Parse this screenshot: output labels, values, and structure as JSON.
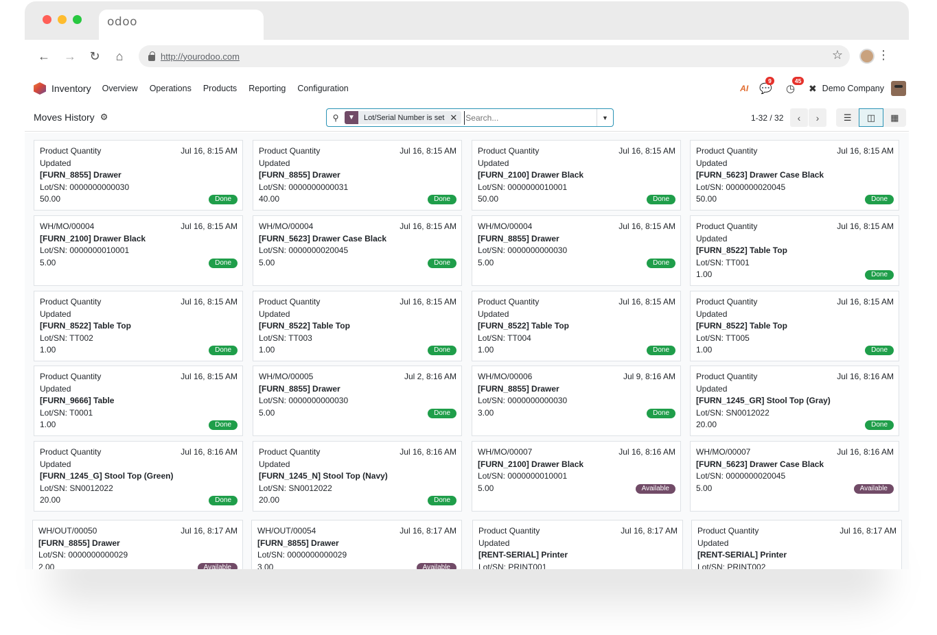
{
  "browser": {
    "tab_title": "odoo",
    "url": "http://yourodoo.com"
  },
  "navbar": {
    "app_name": "Inventory",
    "menu": [
      "Overview",
      "Operations",
      "Products",
      "Reporting",
      "Configuration"
    ],
    "ai_label": "AI",
    "messages_count": "9",
    "activities_count": "45",
    "company": "Demo Company"
  },
  "control": {
    "title": "Moves History",
    "facet_label": "Lot/Serial Number is set",
    "search_placeholder": "Search...",
    "pager": "1-32 / 32"
  },
  "cards": [
    {
      "ref": "Product Quantity",
      "ref2": "Updated",
      "date": "Jul 16, 8:15 AM",
      "product": "[FURN_8855] Drawer",
      "lot": "Lot/SN: 0000000000030",
      "qty": "50.00",
      "state": "Done"
    },
    {
      "ref": "Product Quantity",
      "ref2": "Updated",
      "date": "Jul 16, 8:15 AM",
      "product": "[FURN_8855] Drawer",
      "lot": "Lot/SN: 0000000000031",
      "qty": "40.00",
      "state": "Done"
    },
    {
      "ref": "Product Quantity",
      "ref2": "Updated",
      "date": "Jul 16, 8:15 AM",
      "product": "[FURN_2100] Drawer Black",
      "lot": "Lot/SN: 0000000010001",
      "qty": "50.00",
      "state": "Done"
    },
    {
      "ref": "Product Quantity",
      "ref2": "Updated",
      "date": "Jul 16, 8:15 AM",
      "product": "[FURN_5623] Drawer Case Black",
      "lot": "Lot/SN: 0000000020045",
      "qty": "50.00",
      "state": "Done"
    },
    {
      "ref": "WH/MO/00004",
      "ref2": "",
      "date": "Jul 16, 8:15 AM",
      "product": "[FURN_2100] Drawer Black",
      "lot": "Lot/SN: 0000000010001",
      "qty": "5.00",
      "state": "Done"
    },
    {
      "ref": "WH/MO/00004",
      "ref2": "",
      "date": "Jul 16, 8:15 AM",
      "product": "[FURN_5623] Drawer Case Black",
      "lot": "Lot/SN: 0000000020045",
      "qty": "5.00",
      "state": "Done"
    },
    {
      "ref": "WH/MO/00004",
      "ref2": "",
      "date": "Jul 16, 8:15 AM",
      "product": "[FURN_8855] Drawer",
      "lot": "Lot/SN: 0000000000030",
      "qty": "5.00",
      "state": "Done"
    },
    {
      "ref": "Product Quantity",
      "ref2": "Updated",
      "date": "Jul 16, 8:15 AM",
      "product": "[FURN_8522] Table Top",
      "lot": "Lot/SN: TT001",
      "qty": "1.00",
      "state": "Done"
    },
    {
      "ref": "Product Quantity",
      "ref2": "Updated",
      "date": "Jul 16, 8:15 AM",
      "product": "[FURN_8522] Table Top",
      "lot": "Lot/SN: TT002",
      "qty": "1.00",
      "state": "Done"
    },
    {
      "ref": "Product Quantity",
      "ref2": "Updated",
      "date": "Jul 16, 8:15 AM",
      "product": "[FURN_8522] Table Top",
      "lot": "Lot/SN: TT003",
      "qty": "1.00",
      "state": "Done"
    },
    {
      "ref": "Product Quantity",
      "ref2": "Updated",
      "date": "Jul 16, 8:15 AM",
      "product": "[FURN_8522] Table Top",
      "lot": "Lot/SN: TT004",
      "qty": "1.00",
      "state": "Done"
    },
    {
      "ref": "Product Quantity",
      "ref2": "Updated",
      "date": "Jul 16, 8:15 AM",
      "product": "[FURN_8522] Table Top",
      "lot": "Lot/SN: TT005",
      "qty": "1.00",
      "state": "Done"
    },
    {
      "ref": "Product Quantity",
      "ref2": "Updated",
      "date": "Jul 16, 8:15 AM",
      "product": "[FURN_9666] Table",
      "lot": "Lot/SN: T0001",
      "qty": "1.00",
      "state": "Done"
    },
    {
      "ref": "WH/MO/00005",
      "ref2": "",
      "date": "Jul 2, 8:16 AM",
      "product": "[FURN_8855] Drawer",
      "lot": "Lot/SN: 0000000000030",
      "qty": "5.00",
      "state": "Done"
    },
    {
      "ref": "WH/MO/00006",
      "ref2": "",
      "date": "Jul 9, 8:16 AM",
      "product": "[FURN_8855] Drawer",
      "lot": "Lot/SN: 0000000000030",
      "qty": "3.00",
      "state": "Done"
    },
    {
      "ref": "Product Quantity",
      "ref2": "Updated",
      "date": "Jul 16, 8:16 AM",
      "product": "[FURN_1245_GR] Stool Top (Gray)",
      "lot": "Lot/SN: SN0012022",
      "qty": "20.00",
      "state": "Done"
    },
    {
      "ref": "Product Quantity",
      "ref2": "Updated",
      "date": "Jul 16, 8:16 AM",
      "product": "[FURN_1245_G] Stool Top (Green)",
      "lot": "Lot/SN: SN0012022",
      "qty": "20.00",
      "state": "Done"
    },
    {
      "ref": "Product Quantity",
      "ref2": "Updated",
      "date": "Jul 16, 8:16 AM",
      "product": "[FURN_1245_N] Stool Top (Navy)",
      "lot": "Lot/SN: SN0012022",
      "qty": "20.00",
      "state": "Done"
    },
    {
      "ref": "WH/MO/00007",
      "ref2": "",
      "date": "Jul 16, 8:16 AM",
      "product": "[FURN_2100] Drawer Black",
      "lot": "Lot/SN: 0000000010001",
      "qty": "5.00",
      "state": "Available"
    },
    {
      "ref": "WH/MO/00007",
      "ref2": "",
      "date": "Jul 16, 8:16 AM",
      "product": "[FURN_5623] Drawer Case Black",
      "lot": "Lot/SN: 0000000020045",
      "qty": "5.00",
      "state": "Available"
    },
    {
      "ref": "WH/OUT/00050",
      "ref2": "",
      "date": "Jul 16, 8:17 AM",
      "product": "[FURN_8855] Drawer",
      "lot": "Lot/SN: 0000000000029",
      "qty": "2.00",
      "state": "Available"
    },
    {
      "ref": "WH/OUT/00054",
      "ref2": "",
      "date": "Jul 16, 8:17 AM",
      "product": "[FURN_8855] Drawer",
      "lot": "Lot/SN: 0000000000029",
      "qty": "3.00",
      "state": "Available"
    },
    {
      "ref": "Product Quantity",
      "ref2": "Updated",
      "date": "Jul 16, 8:17 AM",
      "product": "[RENT-SERIAL] Printer",
      "lot": "Lot/SN: PRINT001",
      "qty": "",
      "state": ""
    },
    {
      "ref": "Product Quantity",
      "ref2": "Updated",
      "date": "Jul 16, 8:17 AM",
      "product": "[RENT-SERIAL] Printer",
      "lot": "Lot/SN: PRINT002",
      "qty": "",
      "state": ""
    }
  ],
  "colors": {
    "done": "#1f9e4a",
    "available": "#714b67",
    "accent": "#2a93b5"
  }
}
